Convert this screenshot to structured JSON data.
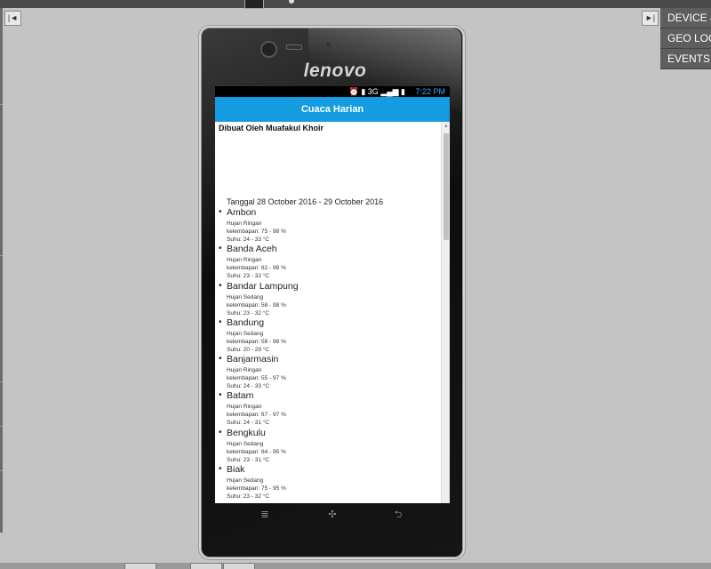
{
  "toolbar": {
    "collapse_label": "|◄",
    "expand_label": "►|"
  },
  "right_menu": {
    "items": [
      {
        "label": "DEVICE & APPS"
      },
      {
        "label": "GEO LOCATION"
      },
      {
        "label": "EVENTS"
      }
    ]
  },
  "phone": {
    "brand": "lenovo"
  },
  "status_bar": {
    "network": "3G",
    "time": "7:22 PM"
  },
  "app": {
    "title": "Cuaca Harian",
    "credit": "Dibuat Oleh Muafakul Khoir",
    "date_range": "Tanggal 28 October 2016 - 29 October 2016",
    "cities": [
      {
        "name": "Ambon",
        "weather": "Hujan Ringan",
        "humidity": "kelembapan: 75 - 98 %",
        "temperature": "Suhu: 24 - 33 °C"
      },
      {
        "name": "Banda Aceh",
        "weather": "Hujan Ringan",
        "humidity": "kelembapan: 62 - 98 %",
        "temperature": "Suhu: 23 - 32 °C"
      },
      {
        "name": "Bandar Lampung",
        "weather": "Hujan Sedang",
        "humidity": "kelembapan: 58 - 98 %",
        "temperature": "Suhu: 23 - 32 °C"
      },
      {
        "name": "Bandung",
        "weather": "Hujan Sedang",
        "humidity": "kelembapan: 58 - 98 %",
        "temperature": "Suhu: 20 - 29 °C"
      },
      {
        "name": "Banjarmasin",
        "weather": "Hujan Ringan",
        "humidity": "kelembapan: 55 - 97 %",
        "temperature": "Suhu: 24 - 33 °C"
      },
      {
        "name": "Batam",
        "weather": "Hujan Ringan",
        "humidity": "kelembapan: 67 - 97 %",
        "temperature": "Suhu: 24 - 31 °C"
      },
      {
        "name": "Bengkulu",
        "weather": "Hujan Sedang",
        "humidity": "kelembapan: 64 - 95 %",
        "temperature": "Suhu: 23 - 31 °C"
      },
      {
        "name": "Biak",
        "weather": "Hujan Sedang",
        "humidity": "kelembapan: 75 - 95 %",
        "temperature": "Suhu: 23 - 32 °C"
      }
    ]
  },
  "nav_keys": {
    "menu_icon": "≣",
    "home_icon": "✣",
    "back_icon": "⮌"
  }
}
